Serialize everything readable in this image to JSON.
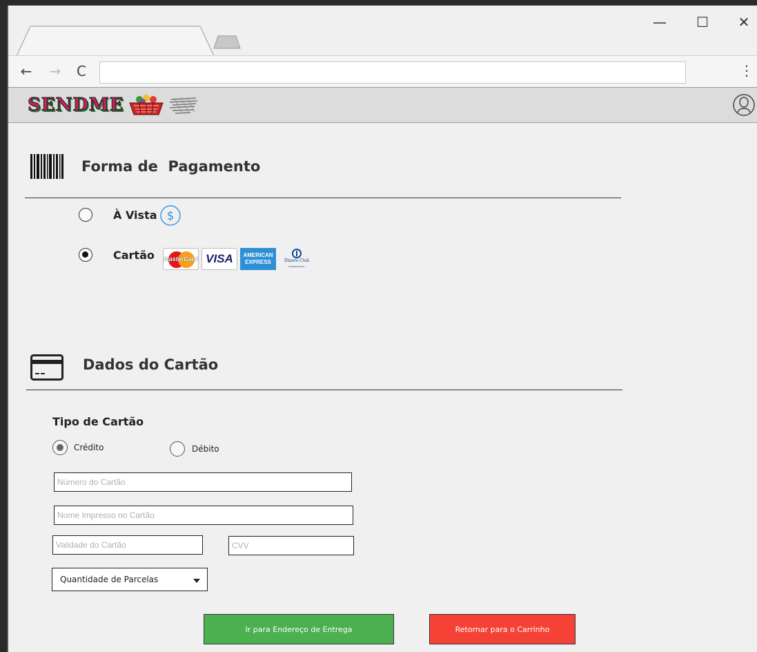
{
  "window": {
    "controls": {
      "minimize": "—",
      "maximize": "☐",
      "close": "✕"
    }
  },
  "browser": {
    "back_glyph": "←",
    "forward_glyph": "→",
    "reload_glyph": "C",
    "menu_glyph": "⋮",
    "address_value": ""
  },
  "site": {
    "logo_text": "SENDME",
    "logo_icons": [
      "basket-icon",
      "speed-lines-icon"
    ],
    "user_icon": "user-icon"
  },
  "payment": {
    "section_icon": "barcode-icon",
    "title": "Forma de  Pagamento",
    "options": [
      {
        "label": "À Vista",
        "selected": false,
        "icon": "dollar-coin-icon",
        "icon_glyph": "$"
      },
      {
        "label": "Cartão",
        "selected": true
      }
    ],
    "card_brands": {
      "mastercard": "MasterCard",
      "visa": "VISA",
      "amex_top": "AMERICAN",
      "amex_bottom": "EXPRESS",
      "diners": "Diners Club",
      "diners_sub": "INTERNATIONAL"
    }
  },
  "card_data": {
    "section_icon": "credit-card-icon",
    "title": "Dados do Cartão",
    "type_title": "Tipo de Cartão",
    "types": [
      {
        "label": "Crédito",
        "selected": true
      },
      {
        "label": "Débito",
        "selected": false
      }
    ],
    "fields": {
      "number_placeholder": "Número do Cartão",
      "name_placeholder": "Nome Impresso no Cartão",
      "validity_placeholder": "Validade do Cartão",
      "cvv_placeholder": "CVV"
    },
    "installments": {
      "selected": "Quantidade de Parcelas"
    }
  },
  "actions": {
    "go_label": "Ir para Endereço de Entrega",
    "back_label": "Retornar para o Carrinho"
  },
  "colors": {
    "go_button": "#4caf50",
    "back_button": "#f44336",
    "coin_icon": "#3a95e8"
  }
}
